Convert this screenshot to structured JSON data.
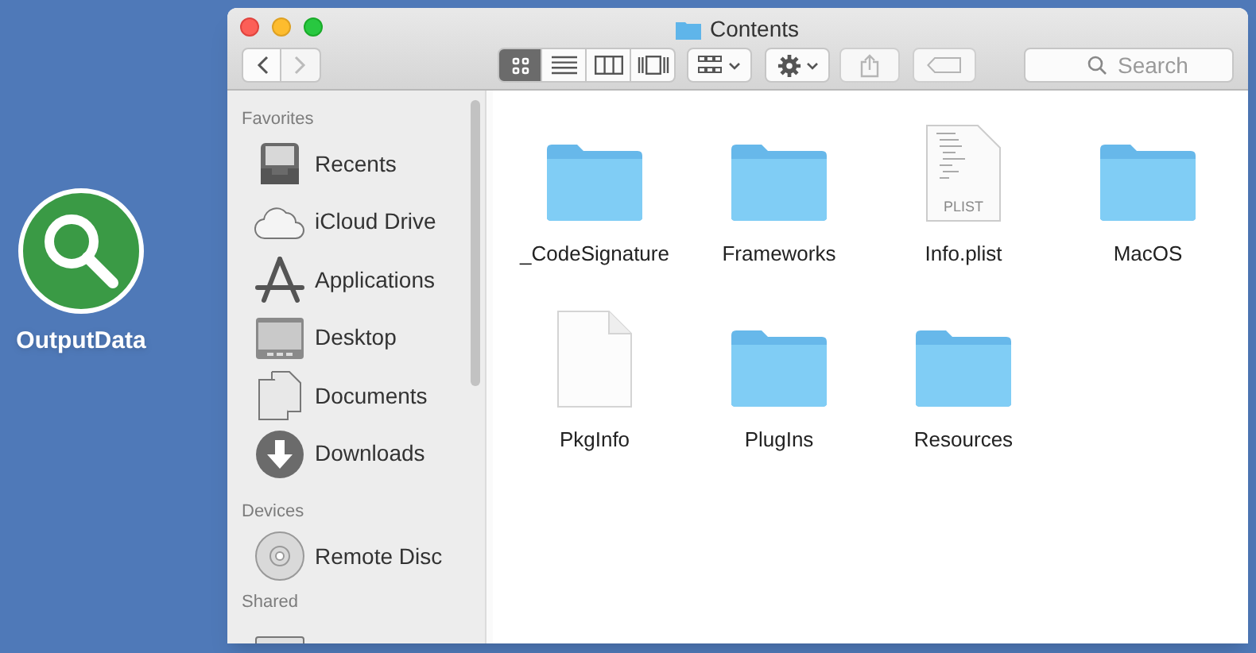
{
  "desktop_icon": {
    "label": "OutputData"
  },
  "window": {
    "title": "Contents"
  },
  "toolbar": {
    "view_buttons": [
      {
        "kind": "icons",
        "selected": true
      },
      {
        "kind": "list",
        "selected": false
      },
      {
        "kind": "columns",
        "selected": false
      },
      {
        "kind": "gallery",
        "selected": false
      }
    ],
    "search": {
      "placeholder": "Search"
    }
  },
  "sidebar": {
    "sections": [
      {
        "title": "Favorites",
        "items": [
          {
            "label": "Recents",
            "kind": "recents"
          },
          {
            "label": "iCloud Drive",
            "kind": "cloud"
          },
          {
            "label": "Applications",
            "kind": "apps"
          },
          {
            "label": "Desktop",
            "kind": "desktop"
          },
          {
            "label": "Documents",
            "kind": "documents"
          },
          {
            "label": "Downloads",
            "kind": "downloads"
          }
        ]
      },
      {
        "title": "Devices",
        "items": [
          {
            "label": "Remote Disc",
            "kind": "disc"
          }
        ]
      },
      {
        "title": "Shared",
        "items": [
          {
            "kind": "computer"
          }
        ]
      }
    ]
  },
  "files": [
    {
      "name": "_CodeSignature",
      "kind": "folder"
    },
    {
      "name": "Frameworks",
      "kind": "folder"
    },
    {
      "name": "Info.plist",
      "kind": "plist",
      "badge": "PLIST"
    },
    {
      "name": "MacOS",
      "kind": "folder"
    },
    {
      "name": "PkgInfo",
      "kind": "file"
    },
    {
      "name": "PlugIns",
      "kind": "folder"
    },
    {
      "name": "Resources",
      "kind": "folder"
    }
  ]
}
